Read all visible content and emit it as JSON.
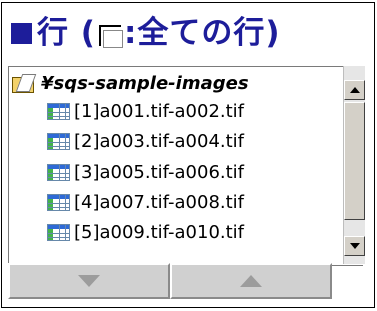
{
  "header": {
    "title_prefix": "行 (",
    "title_suffix": ":全ての行)"
  },
  "tree": {
    "folder_label": "¥sqs-sample-images",
    "files": [
      {
        "label": "[1]a001.tif-a002.tif"
      },
      {
        "label": "[2]a003.tif-a004.tif"
      },
      {
        "label": "[3]a005.tif-a006.tif"
      },
      {
        "label": "[4]a007.tif-a008.tif"
      },
      {
        "label": "[5]a009.tif-a010.tif"
      }
    ]
  },
  "icons": {
    "header_marker": "square-icon",
    "checkbox": "checkbox-icon",
    "folder": "folder-icon",
    "file": "table-icon",
    "move_down": "arrow-down-icon",
    "move_up": "arrow-up-icon"
  },
  "colors": {
    "title": "#1d1d9a",
    "button_face": "#d0d0d0",
    "arrow": "#9c9c9c"
  }
}
